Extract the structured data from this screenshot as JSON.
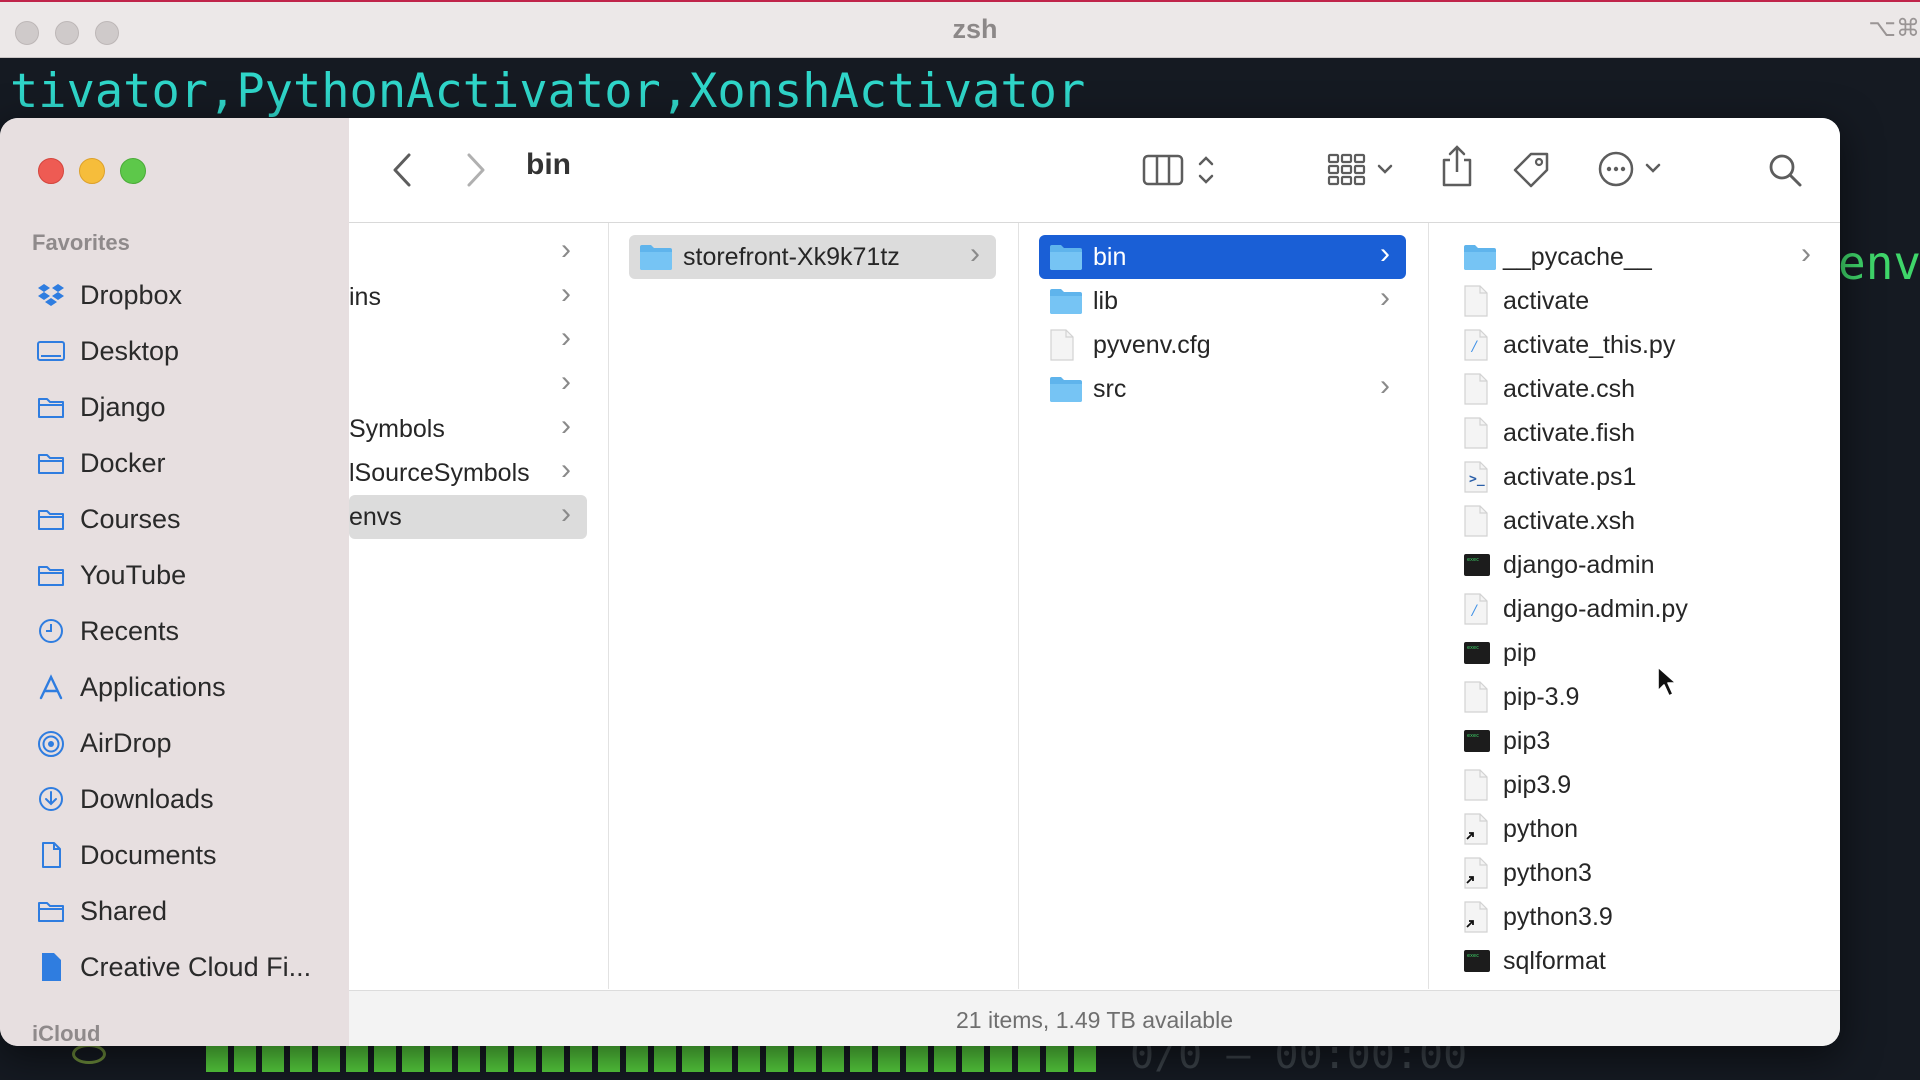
{
  "terminal": {
    "title": "zsh",
    "shortcut": "⌥⌘",
    "line": "tivator,PythonActivator,XonshActivator",
    "right_fragment": "env",
    "stat_text": "0/0 — 00:00:00"
  },
  "finder": {
    "current_folder": "bin",
    "sidebar": {
      "favorites_label": "Favorites",
      "icloud_label": "iCloud",
      "items": [
        {
          "label": "Dropbox",
          "icon": "dropbox-icon"
        },
        {
          "label": "Desktop",
          "icon": "desktop-icon"
        },
        {
          "label": "Django",
          "icon": "folder-icon"
        },
        {
          "label": "Docker",
          "icon": "folder-icon"
        },
        {
          "label": "Courses",
          "icon": "folder-icon"
        },
        {
          "label": "YouTube",
          "icon": "folder-icon"
        },
        {
          "label": "Recents",
          "icon": "clock-icon"
        },
        {
          "label": "Applications",
          "icon": "applications-icon"
        },
        {
          "label": "AirDrop",
          "icon": "airdrop-icon"
        },
        {
          "label": "Downloads",
          "icon": "downloads-icon"
        },
        {
          "label": "Documents",
          "icon": "document-icon"
        },
        {
          "label": "Shared",
          "icon": "folder-icon"
        },
        {
          "label": "Creative Cloud Fi...",
          "icon": "creative-cloud-file-icon"
        }
      ]
    },
    "columns": {
      "col1": [
        {
          "name": ""
        },
        {
          "name": "ins"
        },
        {
          "name": ""
        },
        {
          "name": ""
        },
        {
          "name": "Symbols"
        },
        {
          "name": "lSourceSymbols"
        },
        {
          "name": "envs",
          "selected": true
        }
      ],
      "col2": [
        {
          "name": "storefront-Xk9k71tz",
          "selected": true
        }
      ],
      "col3": [
        {
          "name": "bin",
          "type": "folder",
          "selected": true
        },
        {
          "name": "lib",
          "type": "folder"
        },
        {
          "name": "pyvenv.cfg",
          "type": "doc"
        },
        {
          "name": "src",
          "type": "folder"
        }
      ],
      "col4": [
        {
          "name": "__pycache__",
          "type": "folder"
        },
        {
          "name": "activate",
          "type": "doc"
        },
        {
          "name": "activate_this.py",
          "type": "py"
        },
        {
          "name": "activate.csh",
          "type": "doc"
        },
        {
          "name": "activate.fish",
          "type": "doc"
        },
        {
          "name": "activate.ps1",
          "type": "ps"
        },
        {
          "name": "activate.xsh",
          "type": "doc"
        },
        {
          "name": "django-admin",
          "type": "exec"
        },
        {
          "name": "django-admin.py",
          "type": "py"
        },
        {
          "name": "pip",
          "type": "exec"
        },
        {
          "name": "pip-3.9",
          "type": "doc"
        },
        {
          "name": "pip3",
          "type": "exec"
        },
        {
          "name": "pip3.9",
          "type": "doc"
        },
        {
          "name": "python",
          "type": "alias"
        },
        {
          "name": "python3",
          "type": "alias"
        },
        {
          "name": "python3.9",
          "type": "alias"
        },
        {
          "name": "sqlformat",
          "type": "exec"
        }
      ]
    },
    "status": "21 items, 1.49 TB available"
  }
}
